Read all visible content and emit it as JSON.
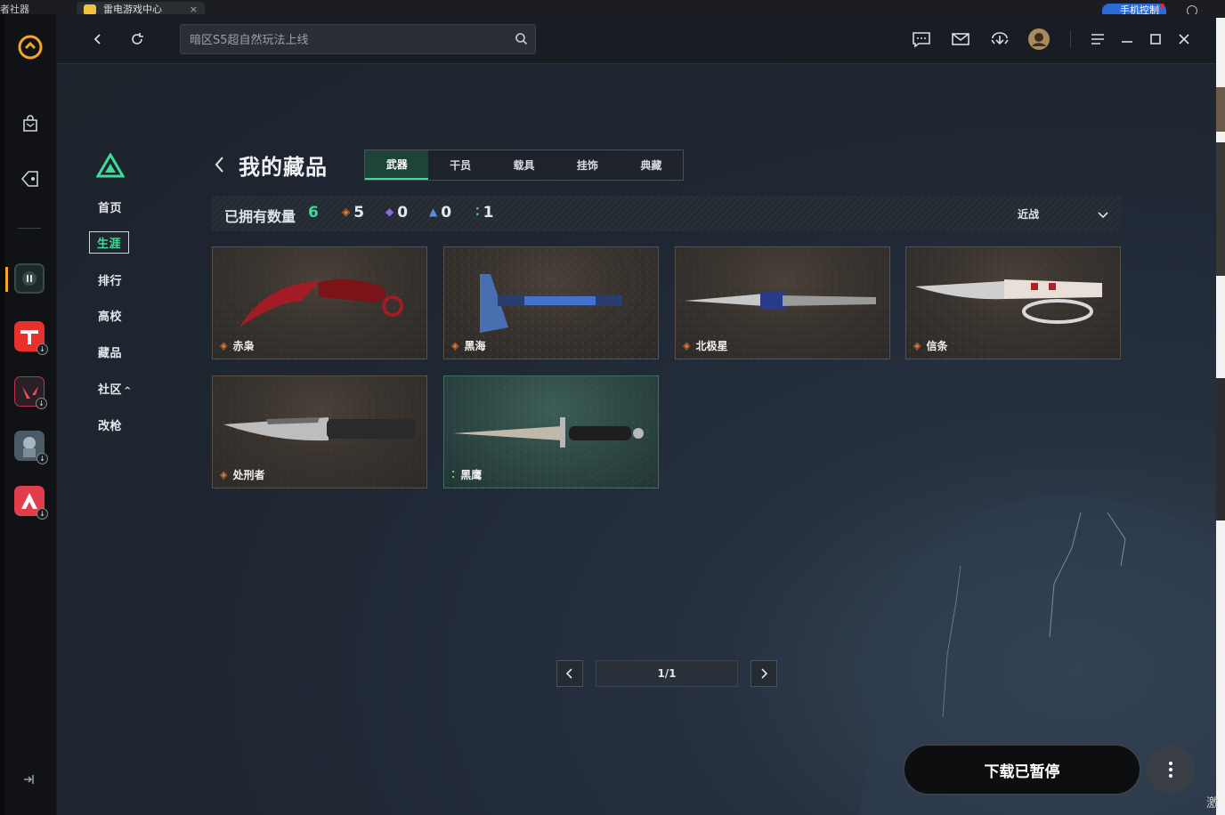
{
  "os": {
    "left_label": "者社器",
    "tab_title": "雷电游戏中心",
    "tab_close": "×",
    "phone_control": "手机控制"
  },
  "search": {
    "placeholder": "暗区S5超自然玩法上线"
  },
  "nav": {
    "items": [
      {
        "label": "首页"
      },
      {
        "label": "生涯"
      },
      {
        "label": "排行"
      },
      {
        "label": "高校"
      },
      {
        "label": "藏品"
      },
      {
        "label": "社区"
      },
      {
        "label": "改枪"
      }
    ],
    "community_caret": "^"
  },
  "page": {
    "title": "我的藏品",
    "tabs": [
      {
        "label": "武器",
        "active": true
      },
      {
        "label": "干员",
        "active": false
      },
      {
        "label": "载具",
        "active": false
      },
      {
        "label": "挂饰",
        "active": false
      },
      {
        "label": "典藏",
        "active": false
      }
    ]
  },
  "stats": {
    "owned_label": "已拥有数量",
    "owned_count": "6",
    "orange_count": "5",
    "purple_count": "0",
    "blue_count": "0",
    "green_count": "1",
    "sort_label": "近战"
  },
  "items": [
    {
      "name": "赤枭",
      "rarity": "orange"
    },
    {
      "name": "黑海",
      "rarity": "orange"
    },
    {
      "name": "北极星",
      "rarity": "orange"
    },
    {
      "name": "信条",
      "rarity": "orange"
    },
    {
      "name": "处刑者",
      "rarity": "orange"
    },
    {
      "name": "黑鹰",
      "rarity": "green"
    }
  ],
  "pager": {
    "page_label": "1/1"
  },
  "download": {
    "label": "下载已暂停"
  },
  "colors": {
    "accent_green": "#3ddc97",
    "rarity_orange": "#e07a3a",
    "rarity_purple": "#8a6ae0",
    "rarity_blue": "#5a8ee0"
  },
  "corner_text": "激"
}
